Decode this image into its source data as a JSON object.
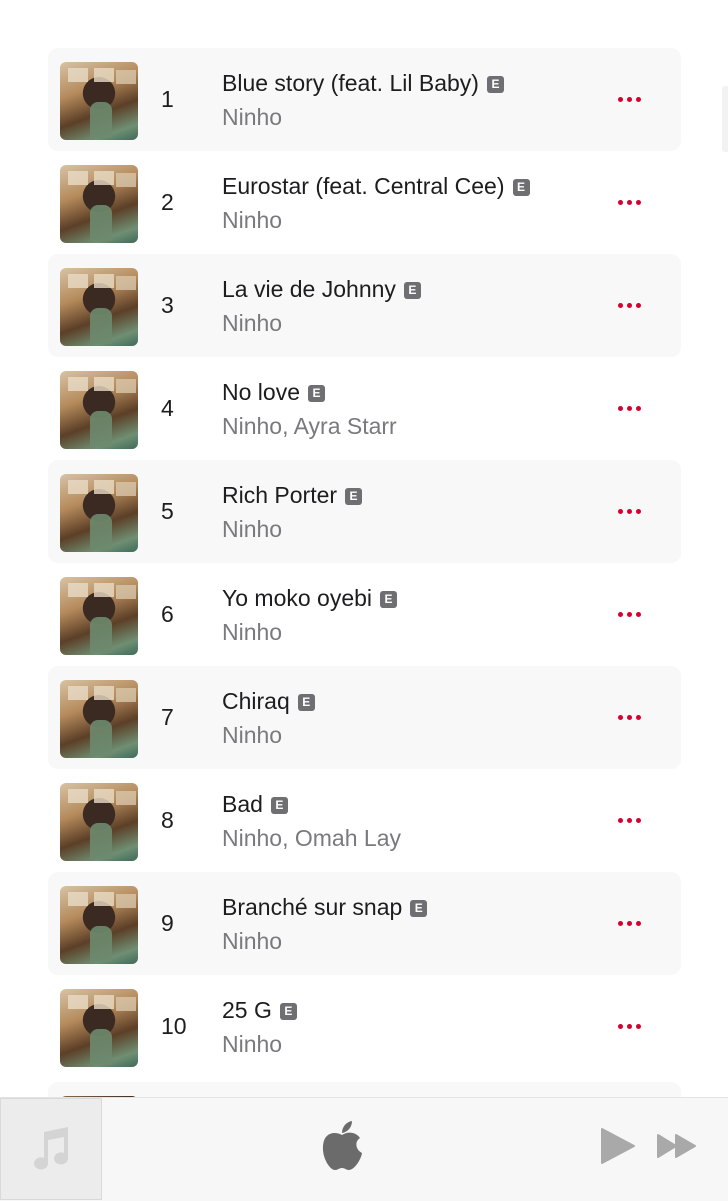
{
  "tracks": [
    {
      "number": "1",
      "title": "Blue story (feat. Lil Baby)",
      "artist": "Ninho",
      "explicit_label": "E"
    },
    {
      "number": "2",
      "title": "Eurostar (feat. Central Cee)",
      "artist": "Ninho",
      "explicit_label": "E"
    },
    {
      "number": "3",
      "title": "La vie de Johnny",
      "artist": "Ninho",
      "explicit_label": "E"
    },
    {
      "number": "4",
      "title": "No love",
      "artist": "Ninho, Ayra Starr",
      "explicit_label": "E"
    },
    {
      "number": "5",
      "title": "Rich Porter",
      "artist": "Ninho",
      "explicit_label": "E"
    },
    {
      "number": "6",
      "title": "Yo moko oyebi",
      "artist": "Ninho",
      "explicit_label": "E"
    },
    {
      "number": "7",
      "title": "Chiraq",
      "artist": "Ninho",
      "explicit_label": "E"
    },
    {
      "number": "8",
      "title": "Bad",
      "artist": "Ninho, Omah Lay",
      "explicit_label": "E"
    },
    {
      "number": "9",
      "title": "Branché sur snap",
      "artist": "Ninho",
      "explicit_label": "E"
    },
    {
      "number": "10",
      "title": "25 G",
      "artist": "Ninho",
      "explicit_label": "E"
    }
  ],
  "icons": {
    "more": "more-options-icon",
    "now_playing_placeholder": "music-note-icon",
    "brand": "apple-logo-icon",
    "play": "play-icon",
    "fast_forward": "fast-forward-icon"
  },
  "colors": {
    "accent": "#d6002e",
    "explicit_badge": "#6e6e73",
    "row_shade": "#f8f8f8",
    "secondary_text": "#7a7a7e",
    "player_controls": "#a0a0a0"
  }
}
